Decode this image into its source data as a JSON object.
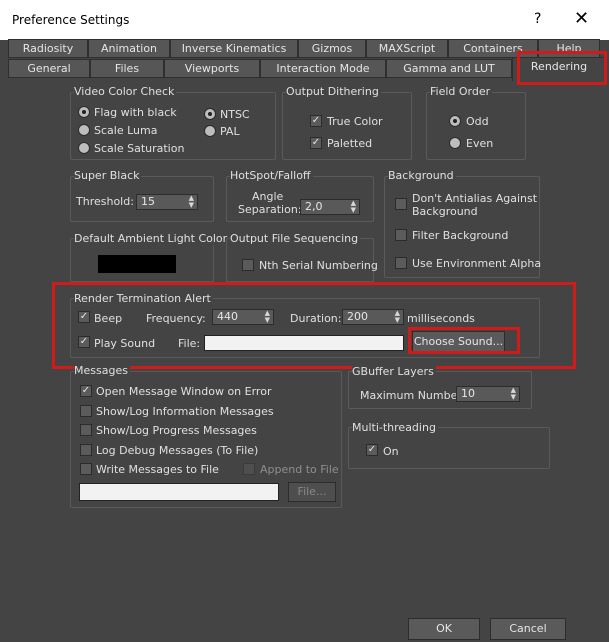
{
  "window": {
    "title": "Preference Settings",
    "help_glyph": "?",
    "close_glyph": "✕"
  },
  "tabs_row1": [
    "Radiosity",
    "Animation",
    "Inverse Kinematics",
    "Gizmos",
    "MAXScript",
    "Containers",
    "Help"
  ],
  "tabs_row2": [
    "General",
    "Files",
    "Viewports",
    "Interaction Mode",
    "Gamma and LUT",
    "Rendering"
  ],
  "video_color_check": {
    "title": "Video Color Check",
    "options": [
      "Flag with black",
      "Scale Luma",
      "Scale Saturation"
    ],
    "standards": [
      "NTSC",
      "PAL"
    ]
  },
  "output_dithering": {
    "title": "Output Dithering",
    "true_color": "True Color",
    "paletted": "Paletted"
  },
  "field_order": {
    "title": "Field Order",
    "odd": "Odd",
    "even": "Even"
  },
  "super_black": {
    "title": "Super Black",
    "threshold_label": "Threshold:",
    "threshold_value": "15"
  },
  "hotspot": {
    "title": "HotSpot/Falloff",
    "angle_label": "Angle",
    "separation_label": "Separation:",
    "separation_value": "2,0"
  },
  "background": {
    "title": "Background",
    "dont_antialias_line1": "Don't Antialias Against",
    "dont_antialias_line2": "Background",
    "filter": "Filter Background",
    "env_alpha": "Use Environment Alpha"
  },
  "ambient": {
    "title": "Default Ambient Light Color",
    "color": "#000000"
  },
  "file_seq": {
    "title": "Output File Sequencing",
    "nth": "Nth Serial Numbering"
  },
  "render_alert": {
    "title": "Render Termination Alert",
    "beep": "Beep",
    "freq_label": "Frequency:",
    "freq_value": "440",
    "duration_label": "Duration:",
    "duration_value": "200",
    "unit": "milliseconds",
    "play_sound": "Play Sound",
    "file_label": "File:",
    "file_value": "",
    "choose_sound": "Choose Sound..."
  },
  "messages": {
    "title": "Messages",
    "items": [
      "Open Message Window on Error",
      "Show/Log Information Messages",
      "Show/Log Progress Messages",
      "Log Debug Messages (To File)",
      "Write Messages to File"
    ],
    "append": "Append to File",
    "file_btn": "File...",
    "file_value": ""
  },
  "gbuffer": {
    "title": "GBuffer Layers",
    "max_label": "Maximum Number:",
    "max_value": "10"
  },
  "multithreading": {
    "title": "Multi-threading",
    "on": "On"
  },
  "footer": {
    "ok": "OK",
    "cancel": "Cancel"
  },
  "annotation_color": "#d11a1a"
}
